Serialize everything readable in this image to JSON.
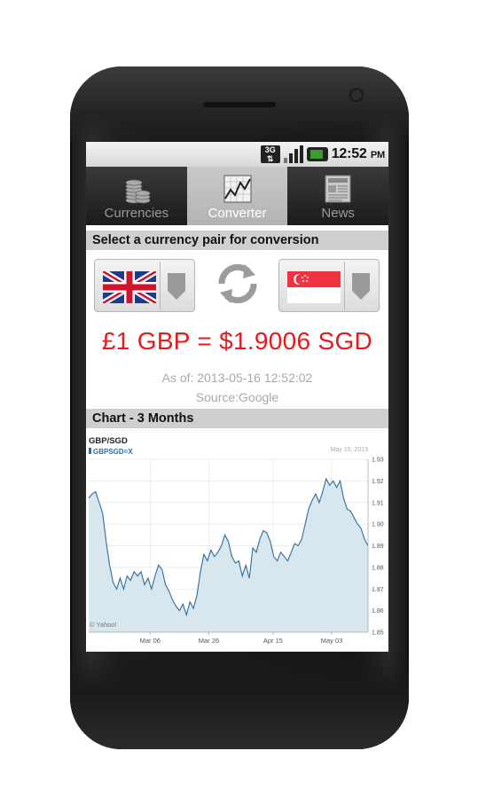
{
  "status_bar": {
    "network": "3G",
    "time": "12:52",
    "ampm": "PM"
  },
  "tabs": [
    {
      "label": "Currencies",
      "icon": "coins-icon",
      "active": false
    },
    {
      "label": "Converter",
      "icon": "chart-icon",
      "active": true
    },
    {
      "label": "News",
      "icon": "newspaper-icon",
      "active": false
    }
  ],
  "converter": {
    "header": "Select a currency pair for conversion",
    "from_flag": "uk-flag-icon",
    "to_flag": "singapore-flag-icon",
    "rate_text": "£1 GBP = $1.9006 SGD",
    "as_of": "As of: 2013-05-16 12:52:02",
    "source": "Source:Google"
  },
  "chart_section": {
    "header": "Chart - 3 Months"
  },
  "chart_data": {
    "type": "area",
    "title": "GBP/SGD",
    "legend": "GBPSGD=X",
    "date_label": "May 15, 2013",
    "credit": "© Yahoo!",
    "x_ticks": [
      "Mar 06",
      "Mar 26",
      "Apr 15",
      "May 03"
    ],
    "y_ticks": [
      "1.93",
      "1.92",
      "1.91",
      "1.90",
      "1.89",
      "1.88",
      "1.87",
      "1.86",
      "1.85"
    ],
    "ylim": [
      1.85,
      1.93
    ],
    "series": [
      {
        "values": [
          1.912,
          1.914,
          1.915,
          1.91,
          1.905,
          1.892,
          1.881,
          1.873,
          1.87,
          1.875,
          1.87,
          1.876,
          1.874,
          1.878,
          1.876,
          1.878,
          1.872,
          1.875,
          1.87,
          1.876,
          1.881,
          1.879,
          1.872,
          1.869,
          1.865,
          1.862,
          1.86,
          1.863,
          1.858,
          1.864,
          1.861,
          1.867,
          1.878,
          1.886,
          1.883,
          1.888,
          1.885,
          1.887,
          1.89,
          1.895,
          1.892,
          1.885,
          1.882,
          1.883,
          1.876,
          1.881,
          1.875,
          1.889,
          1.887,
          1.893,
          1.897,
          1.896,
          1.892,
          1.885,
          1.883,
          1.887,
          1.885,
          1.883,
          1.887,
          1.891,
          1.89,
          1.893,
          1.9,
          1.907,
          1.911,
          1.914,
          1.91,
          1.915,
          1.921,
          1.918,
          1.92,
          1.917,
          1.92,
          1.912,
          1.907,
          1.906,
          1.903,
          1.9,
          1.898,
          1.893,
          1.89
        ]
      }
    ]
  },
  "colors": {
    "rate_red": "#e8191c",
    "chart_fill": "#d8e6ee",
    "chart_line": "#2f6d9c"
  }
}
